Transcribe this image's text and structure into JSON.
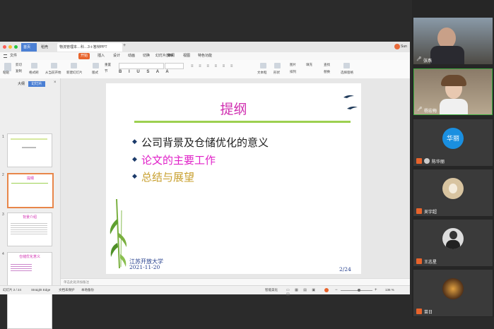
{
  "app": {
    "tabs": [
      {
        "label": "首页"
      },
      {
        "label": "稻壳"
      },
      {
        "label": "物流管理本…科…3＋答辩PPT"
      }
    ],
    "user": "Sun",
    "menus": [
      "文件",
      "开始",
      "插入",
      "设计",
      "动画",
      "切换",
      "幻灯片放映",
      "审阅",
      "视图",
      "特色功能"
    ],
    "ribbon": [
      "粘贴",
      "剪切",
      "复制",
      "格式刷",
      "从当前开始",
      "新建幻灯片",
      "版式",
      "节",
      "重置",
      "文本框",
      "形状",
      "排列",
      "图片",
      "填充",
      "查找",
      "替换",
      "选择窗格"
    ]
  },
  "left_panel": {
    "tabs": [
      "大纲",
      "幻灯片"
    ],
    "slide_numbers": [
      "1",
      "2",
      "3",
      "4",
      "5"
    ],
    "thumb_titles": [
      "提纲",
      "背景介绍",
      "仓储优化意义",
      "仓储现状分析"
    ]
  },
  "slide": {
    "title": "提纲",
    "bullets": [
      {
        "text": "公司背景及仓储优化的意义",
        "color": "#1f1f1f"
      },
      {
        "text": "论文的主要工作",
        "color": "#e020c8"
      },
      {
        "text": "总结与展望",
        "color": "#c8a030"
      }
    ],
    "footer_org": "江苏开放大学",
    "footer_date": "2021-11-20",
    "page": "2/24"
  },
  "notes_placeholder": "单击此处添加备注",
  "status": {
    "slide_info": "幻灯片 2 / 24",
    "theme": "Straight Edge",
    "protect": "文档未保护",
    "backup": "本地备份",
    "remark": "智能美化",
    "zoom": "136 %"
  },
  "participants": [
    {
      "name": "张燕",
      "avatar": "photo",
      "bg": "#5a6a7a"
    },
    {
      "name": "杨宏梅",
      "avatar": "photo",
      "bg": "#7a6a5a"
    },
    {
      "name": "陈华丽",
      "avatar": "华丽",
      "bg": "#1a8fe0"
    },
    {
      "name": "吴宇超",
      "avatar": "dog",
      "bg": "#d8c4a0"
    },
    {
      "name": "王志星",
      "avatar": "person",
      "bg": "#555555"
    },
    {
      "name": "苗日",
      "avatar": "food",
      "bg": "#2f2f2f"
    }
  ]
}
